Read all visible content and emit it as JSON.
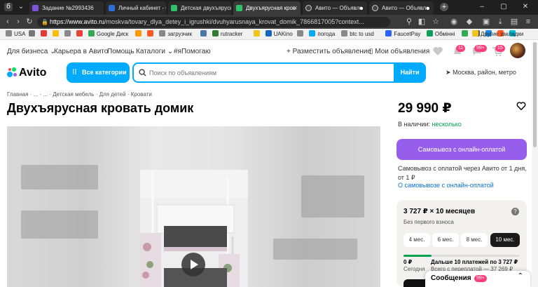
{
  "browser": {
    "tabs": [
      {
        "label": "Задание №2993436",
        "fav_color": "#7b55d8"
      },
      {
        "label": "Личный кабинет - Об",
        "fav_color": "#2f6fd6"
      },
      {
        "label": "Детская двухъярусна",
        "fav_color": "#2ec36b"
      },
      {
        "label": "Двухъярусная кров",
        "fav_color": "#2ec36b"
      },
      {
        "label": "Авито — Объявле",
        "fav_color": "#444444"
      },
      {
        "label": "Авито — Объявле",
        "fav_color": "#444444"
      }
    ],
    "new_tab": "+",
    "url_domain": "https://www.avito.ru",
    "url_path": "/moskva/tovary_dlya_detey_i_igrushki/dvuhyarusnaya_krovat_domik_7866817005?context...",
    "bookmarks": [
      {
        "label": "USA",
        "color": "#888888"
      },
      {
        "label": "",
        "color": "#777777"
      },
      {
        "label": "",
        "color": "#e53935"
      },
      {
        "label": "",
        "color": "#fbbc05"
      },
      {
        "label": "",
        "color": "#888888"
      },
      {
        "label": "",
        "color": "#ea4335"
      },
      {
        "label": "Google Диск",
        "color": "#34a853"
      },
      {
        "label": "",
        "color": "#ff9800"
      },
      {
        "label": "",
        "color": "#ff5722"
      },
      {
        "label": "загрузчик",
        "color": "#888888"
      },
      {
        "label": "",
        "color": "#4a76a8"
      },
      {
        "label": "rutracker",
        "color": "#2e7d32"
      },
      {
        "label": "",
        "color": "#f0c419"
      },
      {
        "label": "UAKino",
        "color": "#1565c0"
      },
      {
        "label": "",
        "color": "#888888"
      },
      {
        "label": "погода",
        "color": "#03a9f4"
      },
      {
        "label": "btc to usd",
        "color": "#888888"
      },
      {
        "label": "FaucetPay",
        "color": "#2962ff"
      },
      {
        "label": "Обмінні",
        "color": "#0f9d58"
      },
      {
        "label": "",
        "color": "#34a853"
      },
      {
        "label": "",
        "color": "#555555"
      },
      {
        "label": "",
        "color": "#1e88e5"
      },
      {
        "label": "",
        "color": "#ff5722"
      },
      {
        "label": "",
        "color": "#00bcd4"
      }
    ],
    "other_bookmarks": "Другие закладки"
  },
  "topnav": {
    "business": "Для бизнеса",
    "career": "Карьера в Авито",
    "help": "Помощь",
    "catalogs": "Каталоги",
    "help_tag": "#яПомогаю",
    "post_ad": "Разместить объявление",
    "my_ads": "Мои объявления",
    "notif_badge": "11",
    "msg_badge": "99+",
    "cart_badge": "15"
  },
  "header": {
    "logo": "Avito",
    "all_categories": "Все категории",
    "search_placeholder": "Поиск по объявлениям",
    "find_button": "Найти",
    "location": "Москва, район, метро"
  },
  "breadcrumbs": {
    "home": "Главная",
    "sep": "·",
    "e1": "...",
    "e2": "...",
    "furniture": "Детская мебель",
    "for_kids": "Для детей",
    "beds": "Кровати"
  },
  "listing": {
    "title": "Двухъярусная кровать домик",
    "price": "29 990 ₽",
    "availability_label": "В наличии:",
    "availability_value": "несколько",
    "pickup_button": "Самовывоз с онлайн-оплатой",
    "pickup_desc": "Самовывоз с оплатой через Авито от 1 дня, от 1 ₽",
    "pickup_link": "О самовывозе с онлайн-оплатой"
  },
  "installment": {
    "title": "3 727 ₽ × 10 месяцев",
    "subtitle": "Без первого взноса",
    "help": "?",
    "terms": [
      "4 мес.",
      "6 мес.",
      "8 мес.",
      "10 мес."
    ],
    "selected_term": "10 мес.",
    "today_amount": "0 ₽",
    "today_label": "Сегодня",
    "next_label": "Дальше 10 платежей по 3 727 ₽",
    "overpay_label": "Всего с переплатой — 37 269 ₽"
  },
  "messages": {
    "label": "Сообщения",
    "badge": "99+"
  }
}
